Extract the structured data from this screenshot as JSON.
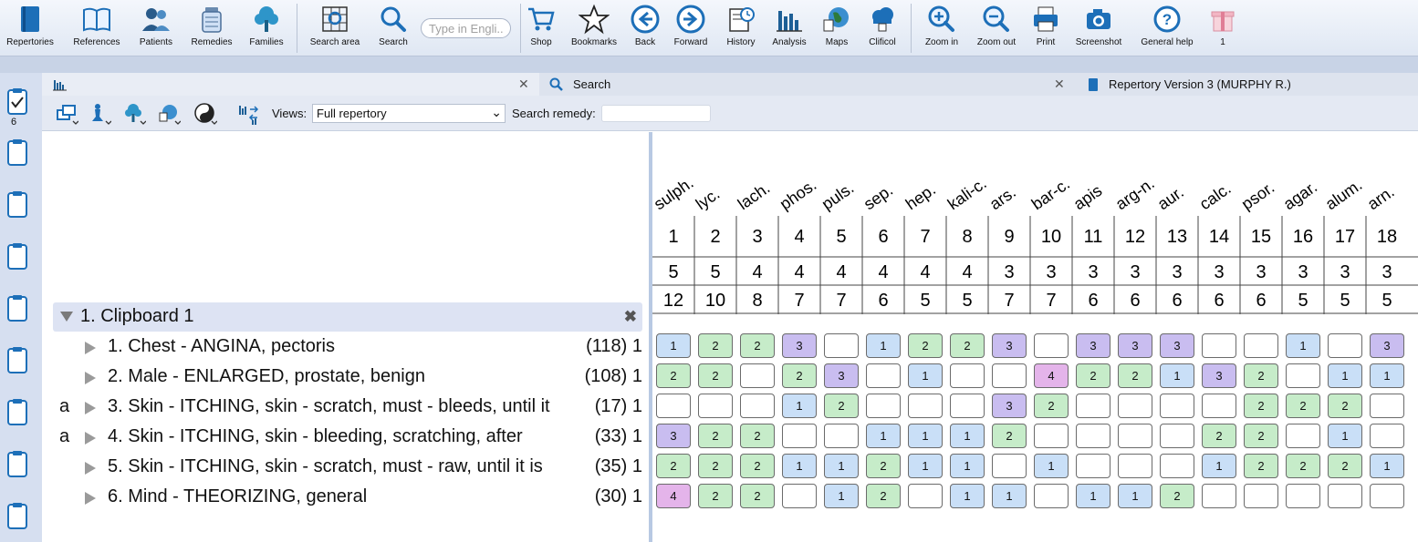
{
  "toolbar": {
    "buttons": [
      {
        "label": "Repertories",
        "icon": "book-icon"
      },
      {
        "label": "References",
        "icon": "open-book-icon"
      },
      {
        "label": "Patients",
        "icon": "people-icon"
      },
      {
        "label": "Remedies",
        "icon": "jar-icon"
      },
      {
        "label": "Families",
        "icon": "tree-icon"
      },
      {
        "label": "Search area",
        "icon": "search-area-icon"
      },
      {
        "label": "Search",
        "icon": "search-icon"
      },
      {
        "label": "Shop",
        "icon": "cart-icon"
      },
      {
        "label": "Bookmarks",
        "icon": "star-icon"
      },
      {
        "label": "Back",
        "icon": "back-arrow-icon"
      },
      {
        "label": "Forward",
        "icon": "forward-arrow-icon"
      },
      {
        "label": "History",
        "icon": "history-icon"
      },
      {
        "label": "Analysis",
        "icon": "bar-chart-icon"
      },
      {
        "label": "Maps",
        "icon": "globe-icon"
      },
      {
        "label": "Clificol",
        "icon": "cloud-icon"
      },
      {
        "label": "Zoom in",
        "icon": "zoom-in-icon"
      },
      {
        "label": "Zoom out",
        "icon": "zoom-out-icon"
      },
      {
        "label": "Print",
        "icon": "printer-icon"
      },
      {
        "label": "Screenshot",
        "icon": "camera-icon"
      },
      {
        "label": "General help",
        "icon": "help-icon"
      },
      {
        "label": "1",
        "icon": "gift-icon"
      }
    ],
    "search_placeholder": "Type in Engli..."
  },
  "left_rail": {
    "count": "6"
  },
  "tabs": [
    {
      "label": ""
    },
    {
      "label": "Search"
    },
    {
      "label": "Repertory Version 3 (MURPHY R.)"
    }
  ],
  "subbar": {
    "views_label": "Views:",
    "views_value": "Full repertory",
    "search_remedy_label": "Search remedy:",
    "search_remedy_value": ""
  },
  "clipboard": {
    "title": "1. Clipboard 1",
    "rubrics": [
      {
        "flag": "",
        "text": "1. Chest - ANGINA, pectoris",
        "count": "(118) 1"
      },
      {
        "flag": "",
        "text": "2. Male - ENLARGED, prostate, benign",
        "count": "(108) 1"
      },
      {
        "flag": "a",
        "text": "3. Skin - ITCHING, skin - scratch, must - bleeds, until it",
        "count": "(17) 1"
      },
      {
        "flag": "a",
        "text": "4. Skin - ITCHING, skin - bleeding, scratching, after",
        "count": "(33) 1"
      },
      {
        "flag": "",
        "text": "5. Skin - ITCHING, skin - scratch, must - raw, until it is",
        "count": "(35) 1"
      },
      {
        "flag": "",
        "text": "6. Mind - THEORIZING, general",
        "count": "(30) 1"
      }
    ]
  },
  "analysis": {
    "remedies": [
      "sulph.",
      "lyc.",
      "lach.",
      "phos.",
      "puls.",
      "sep.",
      "hep.",
      "kali-c.",
      "ars.",
      "bar-c.",
      "apis",
      "arg-n.",
      "aur.",
      "calc.",
      "psor.",
      "agar.",
      "alum.",
      "arn."
    ],
    "rank": [
      "1",
      "2",
      "3",
      "4",
      "5",
      "6",
      "7",
      "8",
      "9",
      "10",
      "11",
      "12",
      "13",
      "14",
      "15",
      "16",
      "17",
      "18"
    ],
    "rubrics_covered": [
      "5",
      "5",
      "4",
      "4",
      "4",
      "4",
      "4",
      "4",
      "3",
      "3",
      "3",
      "3",
      "3",
      "3",
      "3",
      "3",
      "3",
      "3"
    ],
    "total_degrees": [
      "12",
      "10",
      "8",
      "7",
      "7",
      "6",
      "5",
      "5",
      "7",
      "7",
      "6",
      "6",
      "6",
      "6",
      "6",
      "5",
      "5",
      "5"
    ],
    "grades": [
      [
        1,
        2,
        2,
        3,
        0,
        1,
        2,
        2,
        3,
        0,
        3,
        3,
        3,
        0,
        0,
        1,
        0,
        3
      ],
      [
        2,
        2,
        0,
        2,
        3,
        0,
        1,
        0,
        0,
        4,
        2,
        2,
        1,
        3,
        2,
        0,
        1,
        1
      ],
      [
        0,
        0,
        0,
        1,
        2,
        0,
        0,
        0,
        3,
        2,
        0,
        0,
        0,
        0,
        2,
        2,
        2,
        0
      ],
      [
        3,
        2,
        2,
        0,
        0,
        1,
        1,
        1,
        2,
        0,
        0,
        0,
        0,
        2,
        2,
        0,
        1,
        0
      ],
      [
        2,
        2,
        2,
        1,
        1,
        2,
        1,
        1,
        0,
        1,
        0,
        0,
        0,
        1,
        2,
        2,
        2,
        1
      ],
      [
        4,
        2,
        2,
        0,
        1,
        2,
        0,
        1,
        1,
        0,
        1,
        1,
        2,
        0,
        0,
        0,
        0,
        0
      ]
    ]
  }
}
